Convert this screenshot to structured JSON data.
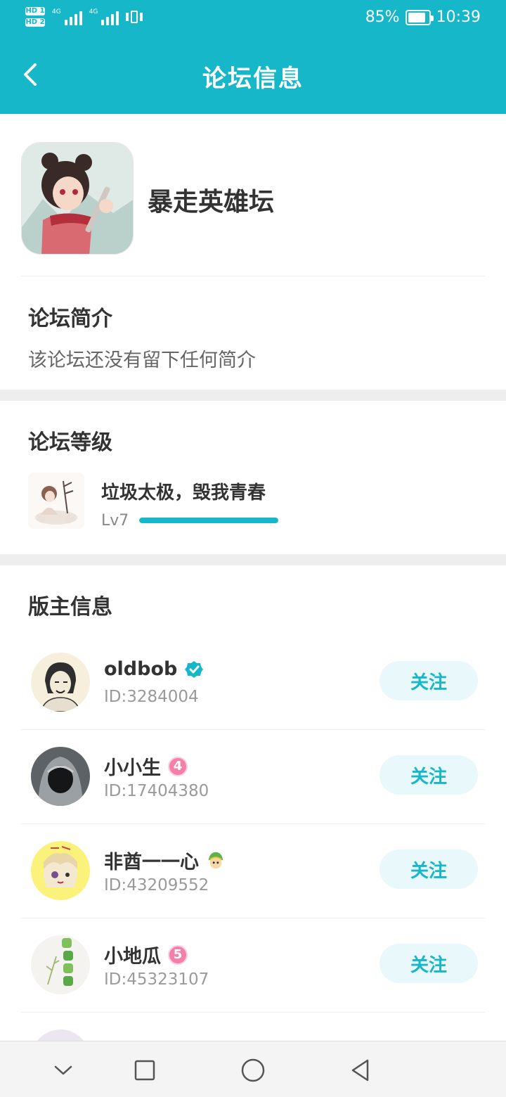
{
  "status_bar": {
    "hd1": "HD 1",
    "hd2": "HD 2",
    "net1": "4G",
    "net2": "4G",
    "battery": "85%",
    "time": "10:39"
  },
  "header": {
    "title": "论坛信息"
  },
  "forum": {
    "name": "暴走英雄坛"
  },
  "intro": {
    "title": "论坛简介",
    "text": "该论坛还没有留下任何简介"
  },
  "level": {
    "title": "论坛等级",
    "name": "垃圾太极，毁我青春",
    "tag": "Lv7",
    "progress_fraction": 1.0
  },
  "moderators": {
    "title": "版主信息",
    "follow_label": "关注",
    "items": [
      {
        "name": "oldbob",
        "id": "ID:3284004",
        "badge": "verified-icon"
      },
      {
        "name": "小小生",
        "id": "ID:17404380",
        "badge": "level-4-badge",
        "badge_text": "4"
      },
      {
        "name": "非酋一一心",
        "id": "ID:43209552",
        "badge": "character-badge"
      },
      {
        "name": "小地瓜",
        "id": "ID:45323107",
        "badge": "level-5-badge",
        "badge_text": "5"
      }
    ]
  },
  "colors": {
    "accent": "#16b7c8",
    "follow_bg": "#e9f8fa",
    "divider": "#eeeeee"
  }
}
